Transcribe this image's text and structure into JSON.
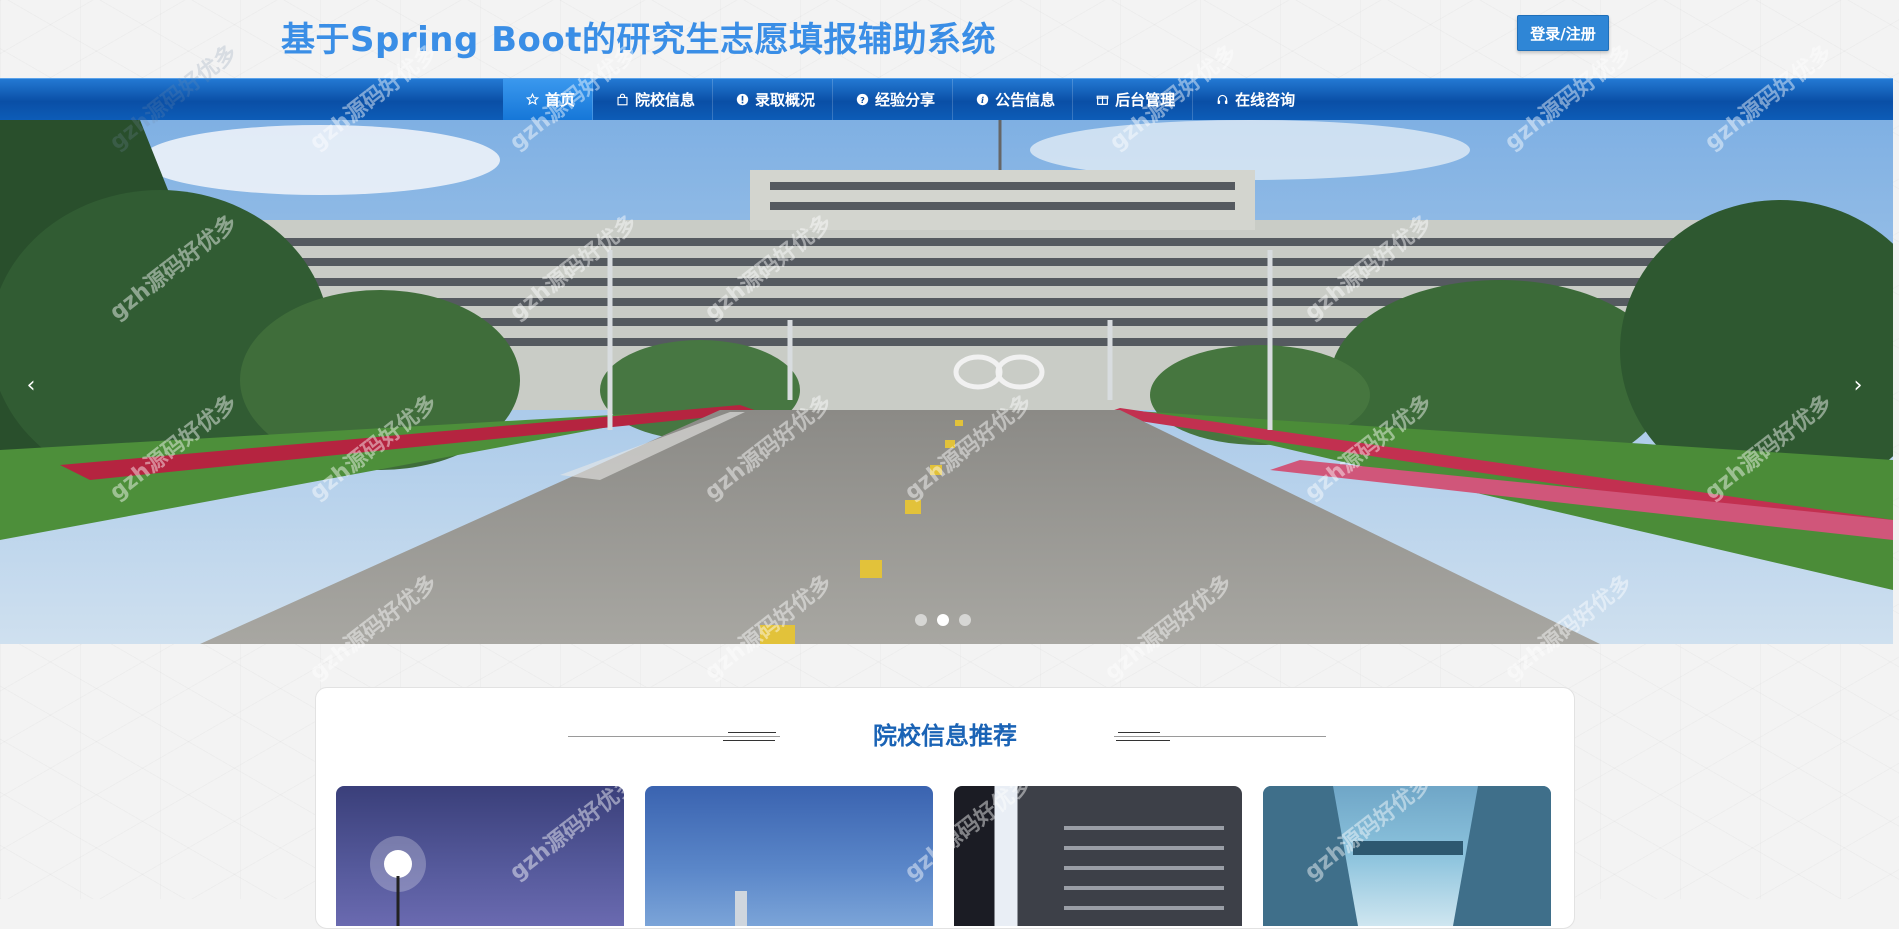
{
  "header": {
    "site_title": "基于Spring Boot的研究生志愿填报辅助系统",
    "login_label": "登录/注册"
  },
  "nav": {
    "items": [
      {
        "label": "首页",
        "icon": "star-icon"
      },
      {
        "label": "院校信息",
        "icon": "bag-icon"
      },
      {
        "label": "录取概况",
        "icon": "exclamation-circle-icon"
      },
      {
        "label": "经验分享",
        "icon": "question-circle-icon"
      },
      {
        "label": "公告信息",
        "icon": "info-circle-icon"
      },
      {
        "label": "后台管理",
        "icon": "gift-icon"
      },
      {
        "label": "在线咨询",
        "icon": "headset-icon"
      }
    ],
    "active_index": 0
  },
  "carousel": {
    "prev_glyph": "‹",
    "next_glyph": "›",
    "slide_count": 3,
    "active_slide": 1
  },
  "recommend": {
    "title": "院校信息推荐",
    "cards": [
      "card-1",
      "card-2",
      "card-3",
      "card-4"
    ]
  },
  "watermark": "gzh源码好优多",
  "colors": {
    "title_blue": "#3a8ee6",
    "nav_blue": "#0a4fa6",
    "section_title": "#1a63b5"
  }
}
